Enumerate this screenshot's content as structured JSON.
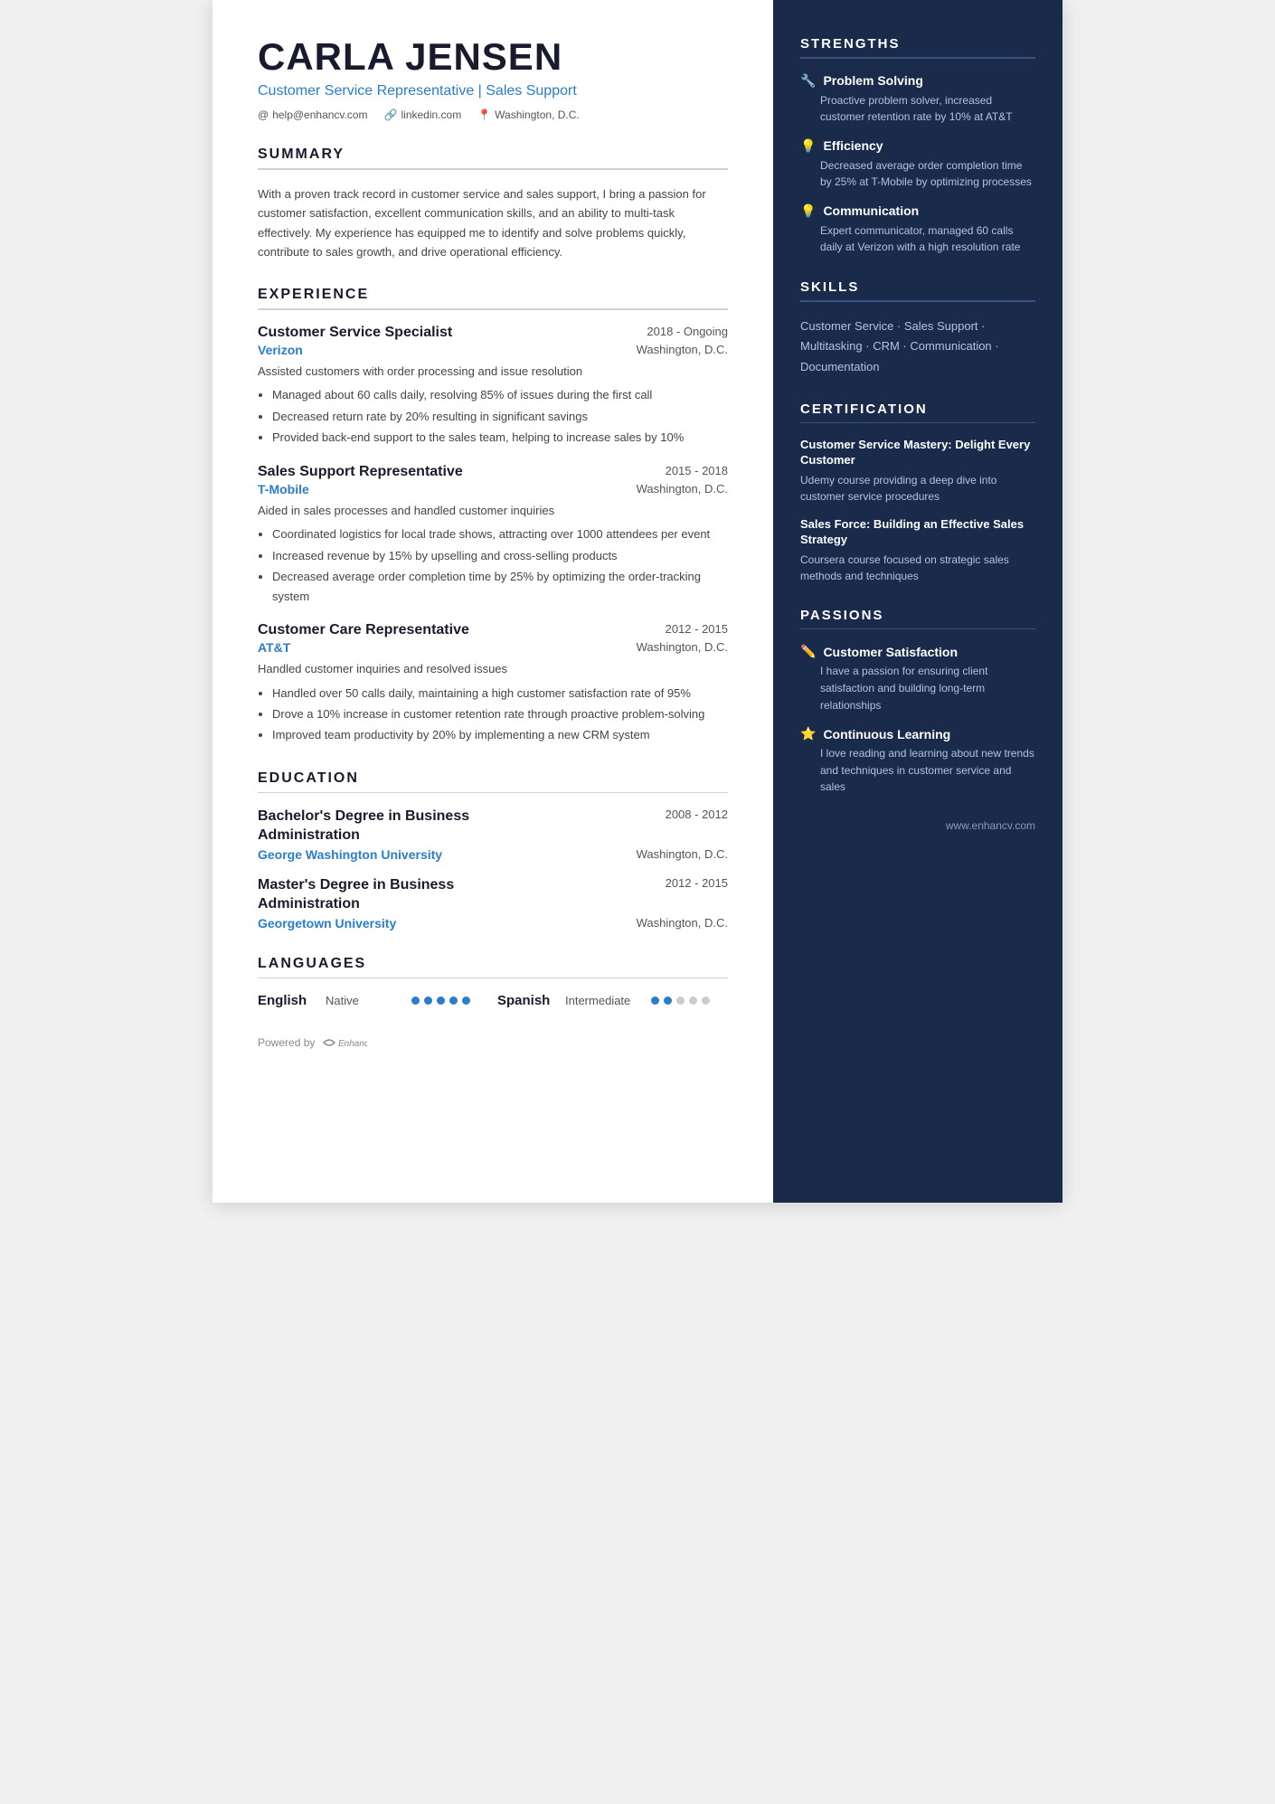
{
  "header": {
    "name": "CARLA JENSEN",
    "title": "Customer Service Representative | Sales Support",
    "email": "help@enhancv.com",
    "linkedin": "linkedin.com",
    "location": "Washington, D.C."
  },
  "summary": {
    "section_label": "SUMMARY",
    "text": "With a proven track record in customer service and sales support, I bring a passion for customer satisfaction, excellent communication skills, and an ability to multi-task effectively. My experience has equipped me to identify and solve problems quickly, contribute to sales growth, and drive operational efficiency."
  },
  "experience": {
    "section_label": "EXPERIENCE",
    "jobs": [
      {
        "title": "Customer Service Specialist",
        "date": "2018 - Ongoing",
        "company": "Verizon",
        "location": "Washington, D.C.",
        "desc": "Assisted customers with order processing and issue resolution",
        "bullets": [
          "Managed about 60 calls daily, resolving 85% of issues during the first call",
          "Decreased return rate by 20% resulting in significant savings",
          "Provided back-end support to the sales team, helping to increase sales by 10%"
        ]
      },
      {
        "title": "Sales Support Representative",
        "date": "2015 - 2018",
        "company": "T-Mobile",
        "location": "Washington, D.C.",
        "desc": "Aided in sales processes and handled customer inquiries",
        "bullets": [
          "Coordinated logistics for local trade shows, attracting over 1000 attendees per event",
          "Increased revenue by 15% by upselling and cross-selling products",
          "Decreased average order completion time by 25% by optimizing the order-tracking system"
        ]
      },
      {
        "title": "Customer Care Representative",
        "date": "2012 - 2015",
        "company": "AT&T",
        "location": "Washington, D.C.",
        "desc": "Handled customer inquiries and resolved issues",
        "bullets": [
          "Handled over 50 calls daily, maintaining a high customer satisfaction rate of 95%",
          "Drove a 10% increase in customer retention rate through proactive problem-solving",
          "Improved team productivity by 20% by implementing a new CRM system"
        ]
      }
    ]
  },
  "education": {
    "section_label": "EDUCATION",
    "degrees": [
      {
        "degree": "Bachelor's Degree in Business Administration",
        "date": "2008 - 2012",
        "university": "George Washington University",
        "location": "Washington, D.C."
      },
      {
        "degree": "Master's Degree in Business Administration",
        "date": "2012 - 2015",
        "university": "Georgetown University",
        "location": "Washington, D.C."
      }
    ]
  },
  "languages": {
    "section_label": "LANGUAGES",
    "items": [
      {
        "name": "English",
        "level": "Native",
        "filled": 5,
        "total": 5
      },
      {
        "name": "Spanish",
        "level": "Intermediate",
        "filled": 2,
        "total": 5
      }
    ]
  },
  "strengths": {
    "section_label": "STRENGTHS",
    "items": [
      {
        "icon": "✏️",
        "title": "Problem Solving",
        "desc": "Proactive problem solver, increased customer retention rate by 10% at AT&T"
      },
      {
        "icon": "💡",
        "title": "Efficiency",
        "desc": "Decreased average order completion time by 25% at T-Mobile by optimizing processes"
      },
      {
        "icon": "💡",
        "title": "Communication",
        "desc": "Expert communicator, managed 60 calls daily at Verizon with a high resolution rate"
      }
    ]
  },
  "skills": {
    "section_label": "SKILLS",
    "text": "Customer Service · Sales Support · Multitasking · CRM · Communication · Documentation"
  },
  "certification": {
    "section_label": "CERTIFICATION",
    "items": [
      {
        "title": "Customer Service Mastery: Delight Every Customer",
        "desc": "Udemy course providing a deep dive into customer service procedures"
      },
      {
        "title": "Sales Force: Building an Effective Sales Strategy",
        "desc": "Coursera course focused on strategic sales methods and techniques"
      }
    ]
  },
  "passions": {
    "section_label": "PASSIONS",
    "items": [
      {
        "icon": "✏️",
        "title": "Customer Satisfaction",
        "desc": "I have a passion for ensuring client satisfaction and building long-term relationships"
      },
      {
        "icon": "⭐",
        "title": "Continuous Learning",
        "desc": "I love reading and learning about new trends and techniques in customer service and sales"
      }
    ]
  },
  "footer": {
    "powered_by": "Powered by",
    "brand": "Enhancv",
    "website": "www.enhancv.com"
  }
}
